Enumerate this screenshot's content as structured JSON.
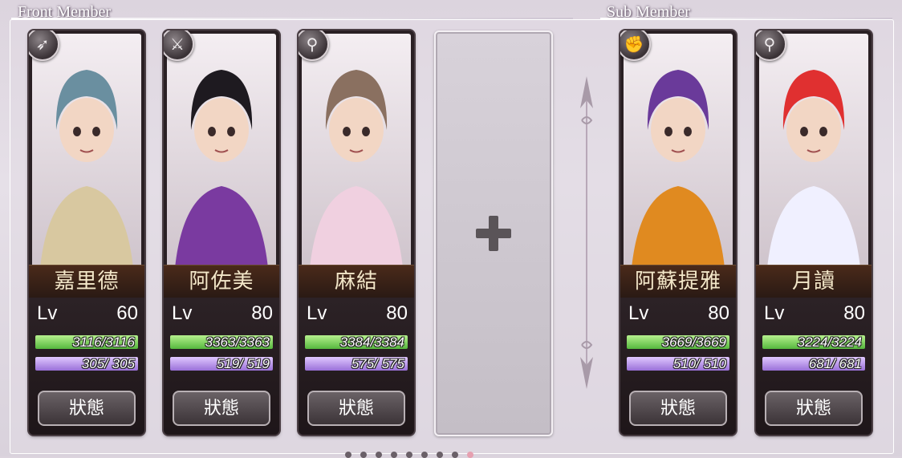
{
  "sections": {
    "front_title": "Front Member",
    "sub_title": "Sub Member"
  },
  "empty_slot": {
    "icon": "plus-icon"
  },
  "members": [
    {
      "name": "嘉里德",
      "lv_label": "Lv",
      "lv": "60",
      "hp": "3116/3116",
      "mp": "305/ 305",
      "status_label": "狀態",
      "class_icon": "bow-icon",
      "hair": "#6a8fa0",
      "accent": "#d8c8a0"
    },
    {
      "name": "阿佐美",
      "lv_label": "Lv",
      "lv": "80",
      "hp": "3363/3363",
      "mp": "519/ 519",
      "status_label": "狀態",
      "class_icon": "sword-icon",
      "hair": "#1e1a20",
      "accent": "#7a3aa0"
    },
    {
      "name": "麻結",
      "lv_label": "Lv",
      "lv": "80",
      "hp": "3384/3384",
      "mp": "575/ 575",
      "status_label": "狀態",
      "class_icon": "staff-icon",
      "hair": "#8a7060",
      "accent": "#f0d0e0"
    },
    {
      "name": "阿蘇提雅",
      "lv_label": "Lv",
      "lv": "80",
      "hp": "3669/3669",
      "mp": "510/ 510",
      "status_label": "狀態",
      "class_icon": "fist-icon",
      "hair": "#6a3a9a",
      "accent": "#e08a20"
    },
    {
      "name": "月讀",
      "lv_label": "Lv",
      "lv": "80",
      "hp": "3224/3224",
      "mp": "681/ 681",
      "status_label": "狀態",
      "class_icon": "staff-icon",
      "hair": "#e03030",
      "accent": "#f0f0ff"
    }
  ],
  "pagination": {
    "count": 9,
    "active": 8
  }
}
